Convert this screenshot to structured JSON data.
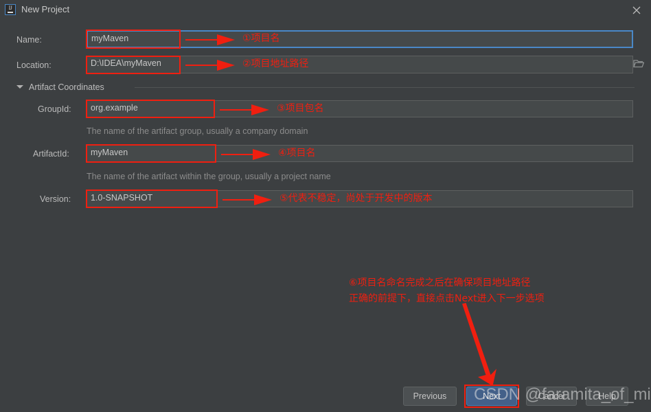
{
  "window": {
    "title": "New Project",
    "icon": "intellij-idea-icon",
    "close_icon": "close-icon"
  },
  "form": {
    "name": {
      "label": "Name:",
      "value": "myMaven"
    },
    "location": {
      "label": "Location:",
      "value": "D:\\IDEA\\myMaven",
      "browse_icon": "folder-icon"
    },
    "artifact_coordinates": {
      "label": "Artifact Coordinates",
      "expanded": true,
      "collapse_icon": "chevron-down-icon"
    },
    "group_id": {
      "label": "GroupId:",
      "value": "org.example",
      "helper": "The name of the artifact group, usually a company domain"
    },
    "artifact_id": {
      "label": "ArtifactId:",
      "value": "myMaven",
      "helper": "The name of the artifact within the group, usually a project name"
    },
    "version": {
      "label": "Version:",
      "value": "1.0-SNAPSHOT"
    }
  },
  "annotations": [
    {
      "id": "a1",
      "text": "①项目名"
    },
    {
      "id": "a2",
      "text": "②项目地址路径"
    },
    {
      "id": "a3",
      "text": "③项目包名"
    },
    {
      "id": "a4",
      "text": "④项目名"
    },
    {
      "id": "a5",
      "text": "⑤代表不稳定，尚处于开发中的版本"
    },
    {
      "id": "a6_line1",
      "text": "⑥项目名命名完成之后在确保项目地址路径"
    },
    {
      "id": "a6_line2",
      "text": "正确的前提下，直接点击Next进入下一步选项"
    }
  ],
  "buttons": {
    "previous": {
      "label": "Previous",
      "mnemonic": "P"
    },
    "next": {
      "label": "Next",
      "mnemonic": "N",
      "primary": true
    },
    "cancel": {
      "label": "Cancel"
    },
    "help": {
      "label": "Help"
    }
  },
  "watermark": {
    "text": "CSDN @faramita_of_mine"
  },
  "colors": {
    "background": "#3c3f41",
    "field_background": "#45494a",
    "focus_border": "#4a88c7",
    "annotation_red": "#f01f10",
    "primary_button": "#436089",
    "text": "#bbbbbb",
    "helper_text": "#8c8c8c"
  }
}
